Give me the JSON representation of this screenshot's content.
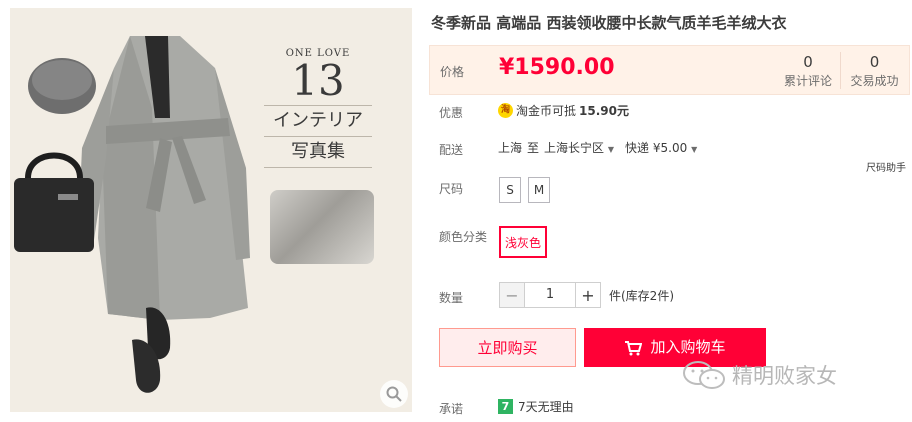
{
  "gallery": {
    "poster_eng": "ONE LOVE",
    "poster_num": "13",
    "poster_jp_1": "インテリア",
    "poster_jp_2": "写真集",
    "zoom_icon": "magnifier-icon"
  },
  "product": {
    "title": "冬季新品 高端品 西装领收腰中长款气质羊毛羊绒大衣"
  },
  "price": {
    "label": "价格",
    "value": "¥1590.00",
    "reviews_count": "0",
    "reviews_label": "累计评论",
    "sales_count": "0",
    "sales_label": "交易成功"
  },
  "promo": {
    "label": "优惠",
    "coin_text": "淘",
    "text": "淘金币可抵",
    "amount": "15.90元"
  },
  "shipping": {
    "label": "配送",
    "from": "上海",
    "to_word": "至",
    "to": "上海长宁区",
    "method": "快递",
    "fee": "¥5.00"
  },
  "size": {
    "label": "尺码",
    "help": "尺码助手",
    "options": [
      "S",
      "M"
    ]
  },
  "color": {
    "label": "颜色分类",
    "selected": "浅灰色"
  },
  "quantity": {
    "label": "数量",
    "minus": "−",
    "value": "1",
    "plus": "+",
    "stock": "件(库存2件)"
  },
  "actions": {
    "buy_now": "立即购买",
    "add_to_cart": "加入购物车"
  },
  "promise": {
    "label": "承诺",
    "badge": "7",
    "text": "7天无理由"
  },
  "watermark": {
    "text": "精明败家女"
  },
  "colors": {
    "accent": "#ff0036",
    "price_bg": "#fff2e8",
    "buy_bg": "#ffeded"
  }
}
